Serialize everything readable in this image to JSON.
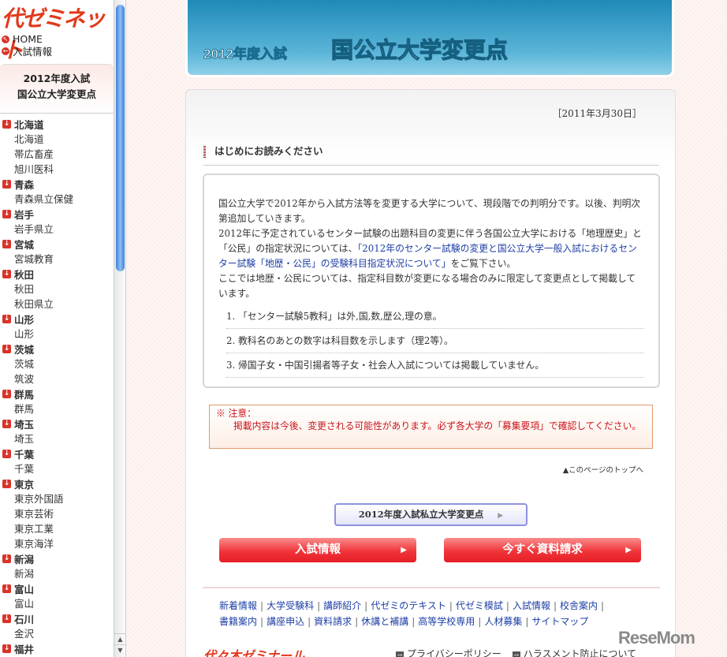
{
  "sidebar": {
    "logo": "代ゼミネット",
    "links": [
      {
        "icon": "arrow-up-left-icon",
        "label": "HOME"
      },
      {
        "icon": "arrow-left-icon",
        "label": "入試情報"
      }
    ],
    "heading": [
      "2012年度入試",
      "国公立大学変更点"
    ],
    "prefectures": [
      {
        "name": "北海道",
        "universities": [
          "北海道",
          "帯広畜産",
          "旭川医科"
        ]
      },
      {
        "name": "青森",
        "universities": [
          "青森県立保健"
        ]
      },
      {
        "name": "岩手",
        "universities": [
          "岩手県立"
        ]
      },
      {
        "name": "宮城",
        "universities": [
          "宮城教育"
        ]
      },
      {
        "name": "秋田",
        "universities": [
          "秋田",
          "秋田県立"
        ]
      },
      {
        "name": "山形",
        "universities": [
          "山形"
        ]
      },
      {
        "name": "茨城",
        "universities": [
          "茨城",
          "筑波"
        ]
      },
      {
        "name": "群馬",
        "universities": [
          "群馬"
        ]
      },
      {
        "name": "埼玉",
        "universities": [
          "埼玉"
        ]
      },
      {
        "name": "千葉",
        "universities": [
          "千葉"
        ]
      },
      {
        "name": "東京",
        "universities": [
          "東京外国語",
          "東京芸術",
          "東京工業",
          "東京海洋"
        ]
      },
      {
        "name": "新潟",
        "universities": [
          "新潟"
        ]
      },
      {
        "name": "富山",
        "universities": [
          "富山"
        ]
      },
      {
        "name": "石川",
        "universities": [
          "金沢"
        ]
      },
      {
        "name": "福井",
        "universities": []
      }
    ]
  },
  "banner": {
    "year": "2012年度入試",
    "title": "国公立大学変更点"
  },
  "main": {
    "date": "［2011年3月30日］",
    "section_title": "はじめにお読みください",
    "intro": {
      "p1": "国公立大学で2012年から入試方法等を変更する大学について、現段階での判明分です。以後、判明次第追加していきます。",
      "p2_before": "2012年に予定されているセンター試験の出題科目の変更に伴う各国公立大学における「地理歴史」と「公民」の指定状況については、",
      "p2_link": "「2012年のセンター試験の変更と国公立大学一般入試におけるセンター試験「地歴・公民」の受験科目指定状況について」",
      "p2_after": "をご覧下さい。",
      "p3": "ここでは地歴・公民については、指定科目数が変更になる場合のみに限定して変更点として掲載しています。",
      "notes": [
        "1. 「センター試験5教科」は外,国,数,歴公,理の意。",
        "2. 教科名のあとの数字は科目数を示します（理2等）。",
        "3. 帰国子女・中国引揚者等子女・社会人入試については掲載していません。"
      ]
    },
    "notice": {
      "title": "※ 注意：",
      "body": "掲載内容は今後、変更される可能性があります。必ず各大学の「募集要項」で確認してください。"
    },
    "to_top": "▲このページのトップへ",
    "private_button": "2012年度入試私立大学変更点",
    "button_exam_info": "入試情報",
    "button_request": "今すぐ資料請求"
  },
  "footer": {
    "links_row1": [
      "新着情報",
      "大学受験科",
      "講師紹介",
      "代ゼミのテキスト",
      "代ゼミ模試",
      "入試情報",
      "校舎案内"
    ],
    "links_row2": [
      "書籍案内",
      "講座申込",
      "資料請求",
      "休講と補講",
      "高等学校専用",
      "人材募集",
      "サイトマップ"
    ],
    "logo": "代々木ゼミナール",
    "policy": [
      "プライバシーポリシー",
      "ハラスメント防止について"
    ]
  },
  "watermark": "ReseMom",
  "colors": {
    "accent_red": "#e2391c",
    "link_blue": "#1d3ea5",
    "banner_blue": "#1f8ab8"
  }
}
